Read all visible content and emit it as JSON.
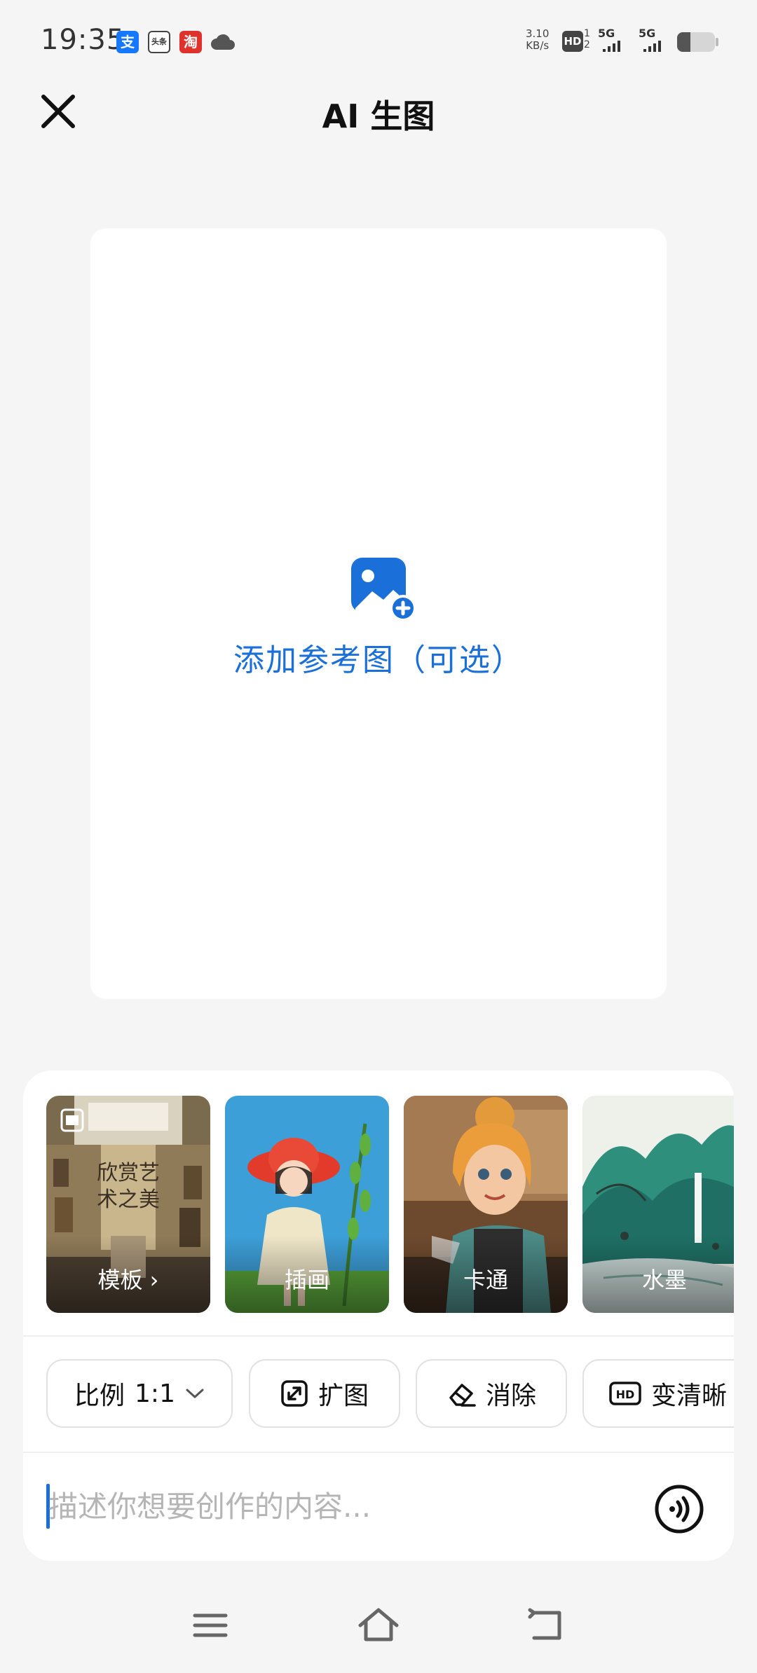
{
  "status_bar": {
    "time": "19:35",
    "apps": [
      {
        "name": "alipay-icon",
        "glyph": "支",
        "color": "#1677ff"
      },
      {
        "name": "toutiao-icon",
        "glyph": "头条",
        "color": "#444444"
      },
      {
        "name": "taobao-icon",
        "glyph": "淘",
        "color": "#e0322b"
      },
      {
        "name": "cloud-icon",
        "glyph": "",
        "color": "#555555"
      }
    ],
    "net_speed_value": "3.10",
    "net_speed_unit": "KB/s",
    "hd_label": "HD",
    "sim_numbers": [
      "1",
      "2"
    ],
    "signal_1_label": "5G",
    "signal_2_label": "5G",
    "battery_level": 0.35
  },
  "header": {
    "title": "AI 生图",
    "close_icon": "close-icon"
  },
  "reference": {
    "label": "添加参考图（可选）",
    "icon": "add-image-icon",
    "accent": "#1a6fd8"
  },
  "styles": [
    {
      "label": "模板 ›",
      "art": "gallery"
    },
    {
      "label": "插画",
      "art": "illustration"
    },
    {
      "label": "卡通",
      "art": "cartoon"
    },
    {
      "label": "水墨",
      "art": "ink"
    }
  ],
  "gallery_poster_text": "欣赏艺术之美",
  "tools": {
    "ratio_label": "比例",
    "ratio_value": "1:1",
    "expand_label": "扩图",
    "erase_label": "消除",
    "enhance_label": "变清晰",
    "enhance_badge": "HD"
  },
  "prompt": {
    "placeholder": "描述你想要创作的内容...",
    "value": ""
  },
  "nav": {
    "menu_icon": "menu-icon",
    "home_icon": "home-icon",
    "back_icon": "back-icon"
  }
}
